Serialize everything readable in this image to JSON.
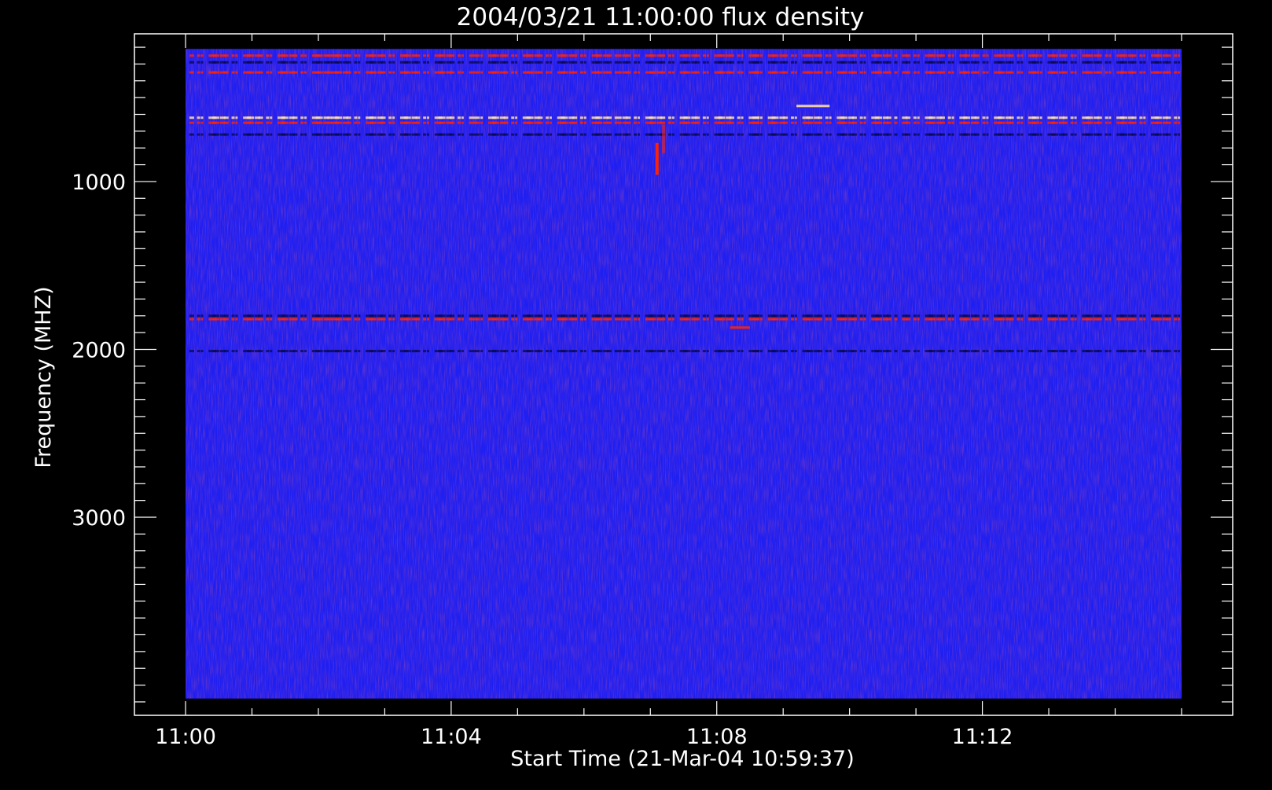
{
  "chart_data": {
    "type": "heatmap",
    "title": "2004/03/21 11:00:00 flux density",
    "xlabel": "Start Time (21-Mar-04 10:59:37)",
    "ylabel": "Frequency (MHZ)",
    "x_tick_labels": [
      "11:00",
      "11:04",
      "11:08",
      "11:12"
    ],
    "x_ticks_minutes": [
      0,
      4,
      8,
      12
    ],
    "x_minor_step_minutes": 1,
    "xlim_minutes": [
      -0.77,
      15.77
    ],
    "y_tick_labels": [
      "1000",
      "2000",
      "3000"
    ],
    "y_ticks_mhz": [
      1000,
      2000,
      3000
    ],
    "y_minor_step_mhz": 100,
    "ylim_mhz": [
      4180,
      120
    ],
    "y_inverted": true,
    "data_extent": {
      "time_minutes": [
        0,
        15
      ],
      "frequency_mhz": [
        210,
        4080
      ]
    },
    "background_color": "#1f1ff2",
    "colors": {
      "background": "#000000",
      "axes": "#ffffff",
      "low_flux": "#1f1ff2",
      "high_flux": "#ff2200",
      "peak_flux": "#ffe0a0",
      "dark_band": "#0a0a50"
    },
    "horizontal_bands": [
      {
        "freq_mhz": 250,
        "kind": "red"
      },
      {
        "freq_mhz": 290,
        "kind": "dark"
      },
      {
        "freq_mhz": 350,
        "kind": "red"
      },
      {
        "freq_mhz": 620,
        "kind": "bright"
      },
      {
        "freq_mhz": 650,
        "kind": "red"
      },
      {
        "freq_mhz": 720,
        "kind": "dark"
      },
      {
        "freq_mhz": 1800,
        "kind": "dark"
      },
      {
        "freq_mhz": 1820,
        "kind": "red"
      },
      {
        "freq_mhz": 2010,
        "kind": "dark"
      }
    ],
    "features": [
      {
        "label": "burst",
        "time_minutes": 7.1,
        "freq_range_mhz": [
          770,
          960
        ],
        "intensity": "high"
      },
      {
        "label": "burst",
        "time_minutes": 7.2,
        "freq_range_mhz": [
          660,
          830
        ],
        "intensity": "medium"
      },
      {
        "label": "patch",
        "time_range_minutes": [
          9.2,
          9.7
        ],
        "freq_mhz": 550,
        "intensity": "peak"
      },
      {
        "label": "patch",
        "time_range_minutes": [
          8.2,
          8.5
        ],
        "freq_mhz": 1870,
        "intensity": "medium"
      }
    ]
  }
}
